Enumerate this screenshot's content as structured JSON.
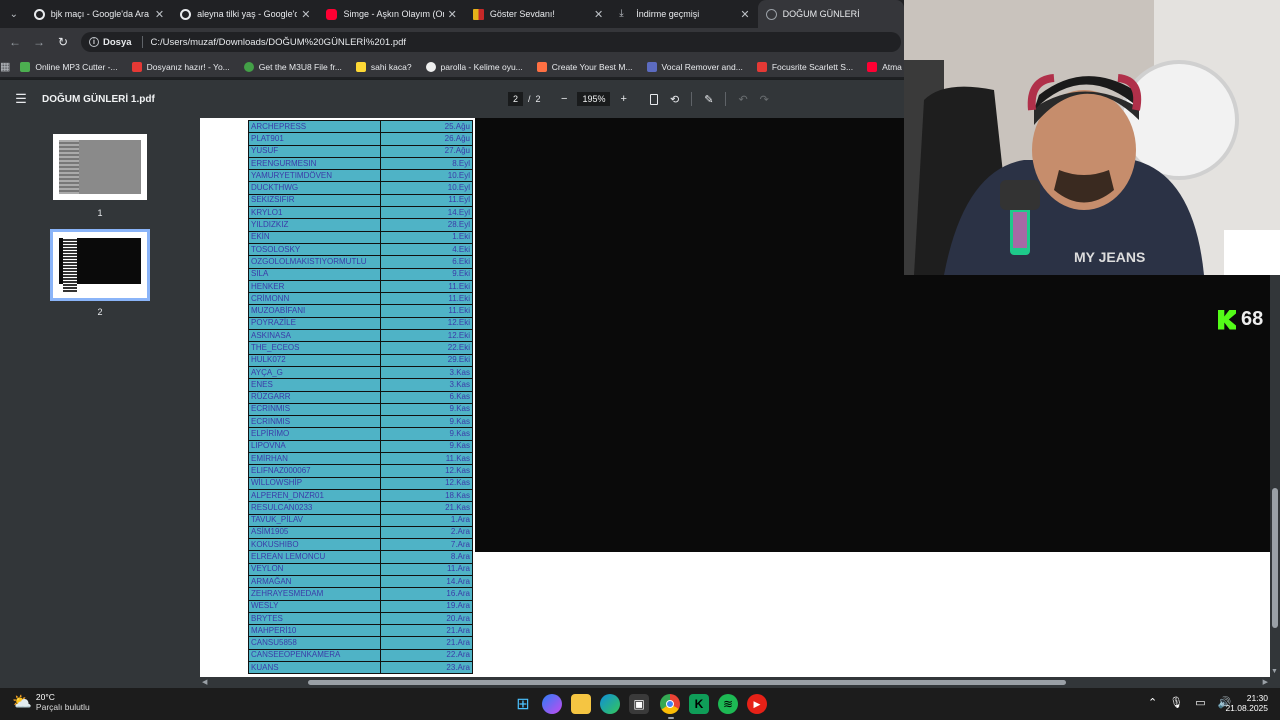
{
  "browser": {
    "tabs": [
      {
        "title": "bjk maçı - Google'da Ara",
        "favicon_color": "#e8eaed"
      },
      {
        "title": "aleyna tilki yaş - Google'da Ara",
        "favicon_color": "#e8eaed"
      },
      {
        "title": "Simge - Aşkın Olayım (Onurr)",
        "favicon_color": "#ff0033"
      },
      {
        "title": "Göster Sevdanı!",
        "favicon_color": "#e5b21a"
      },
      {
        "title": "İndirme geçmişi",
        "favicon_color": "#9aa0a6"
      },
      {
        "title": "DOĞUM GÜNLERİ",
        "favicon_color": "#9aa0a6"
      }
    ],
    "close_glyph": "✕",
    "address": {
      "scheme_chip": "Dosya",
      "url": "C:/Users/muzaf/Downloads/DO%C4%9EUM%20G%C3%9CNLER%C4%B0%201.pdf"
    },
    "url_display": "C:/Users/muzaf/Downloads/DOĞUM%20GÜNLERİ%201.pdf",
    "bookmarks": [
      {
        "label": "Online MP3 Cutter -...",
        "color": "#4caf50"
      },
      {
        "label": "Dosyanız hazır! - Yo...",
        "color": "#e53935"
      },
      {
        "label": "Get the M3U8 File fr...",
        "color": "#43a047"
      },
      {
        "label": "sahi kaca?",
        "color": "#fdd835"
      },
      {
        "label": "parolla - Kelime oyu...",
        "color": "#eeeeee"
      },
      {
        "label": "Create Your Best M...",
        "color": "#ff7043"
      },
      {
        "label": "Vocal Remover and...",
        "color": "#5c6bc0"
      },
      {
        "label": "Focusrite Scarlett S...",
        "color": "#e53935"
      },
      {
        "label": "Atma - YouTube",
        "color": "#ff0033"
      }
    ]
  },
  "pdf": {
    "title": "DOĞUM GÜNLERİ 1.pdf",
    "page_current": "2",
    "page_sep": "/",
    "page_total": "2",
    "zoom": "195%",
    "thumbnails": [
      {
        "label": "1"
      },
      {
        "label": "2"
      }
    ],
    "rows": [
      [
        "ARCHEPRESS",
        "25.Ağu"
      ],
      [
        "PLAT901",
        "26.Ağu"
      ],
      [
        "YUSUF",
        "27.Ağu"
      ],
      [
        "ERENGURMESIN",
        "8.Eyl"
      ],
      [
        "YAMURYETIMDÖVEN",
        "10.Eyl"
      ],
      [
        "DUCKTHWG",
        "10.Eyl"
      ],
      [
        "SEKIZSIFIR",
        "11.Eyl"
      ],
      [
        "KRYLO1",
        "14.Eyl"
      ],
      [
        "YILDIZKIZ",
        "28.Eyl"
      ],
      [
        "EKİN",
        "1.Eki"
      ],
      [
        "TOSOLOSKY",
        "4.Eki"
      ],
      [
        "OZGOLOLMAKISTIYORMUTLU",
        "6.Eki"
      ],
      [
        "SILA",
        "9.Eki"
      ],
      [
        "HENKER",
        "11.Eki"
      ],
      [
        "CRİMONN",
        "11.Eki"
      ],
      [
        "MUZOABİFANI",
        "11.Eki"
      ],
      [
        "POYRAZİLE",
        "12.Eki"
      ],
      [
        "ASKINASA",
        "12.Eki"
      ],
      [
        "THE_ECEOS",
        "22.Eki"
      ],
      [
        "HULK072",
        "29.Eki"
      ],
      [
        "AYÇA_G",
        "3.Kas"
      ],
      [
        "ENES",
        "3.Kas"
      ],
      [
        "RÜZGARR",
        "6.Kas"
      ],
      [
        "ECRINMIS",
        "9.Kas"
      ],
      [
        "ECRINMIS",
        "9.Kas"
      ],
      [
        "ELPİRİMO",
        "9.Kas"
      ],
      [
        "LIPOVNA",
        "9.Kas"
      ],
      [
        "EMİRHAN",
        "11.Kas"
      ],
      [
        "ELIFNAZ000067",
        "12.Kas"
      ],
      [
        "WİLLOWSHİP",
        "12.Kas"
      ],
      [
        "ALPEREN_DNZR01",
        "18.Kas"
      ],
      [
        "RESULCAN0233",
        "21.Kas"
      ],
      [
        "TAVUK_PİLAV",
        "1.Ara"
      ],
      [
        "ASİM1905",
        "2.Ara"
      ],
      [
        "KOKUSHIBO",
        "7.Ara"
      ],
      [
        "ELREAN LEMONCU",
        "8.Ara"
      ],
      [
        "VEYLON",
        "11.Ara"
      ],
      [
        "ARMAĞAN",
        "14.Ara"
      ],
      [
        "ZEHRAYESMEDAM",
        "16.Ara"
      ],
      [
        "WESLY",
        "19.Ara"
      ],
      [
        "BRYTES",
        "20.Ara"
      ],
      [
        "MAHPERİ10",
        "21.Ara"
      ],
      [
        "CANSU5858",
        "21.Ara"
      ],
      [
        "CANSEEOPENKAMERA",
        "22.Ara"
      ],
      [
        "KUANS",
        "23.Ara"
      ]
    ]
  },
  "overlay": {
    "kick_count": "68",
    "kick_color": "#53fc18"
  },
  "taskbar": {
    "weather_temp": "20°C",
    "weather_desc": "Parçalı bulutlu",
    "time": "21:30",
    "date": "21.08.2025"
  }
}
